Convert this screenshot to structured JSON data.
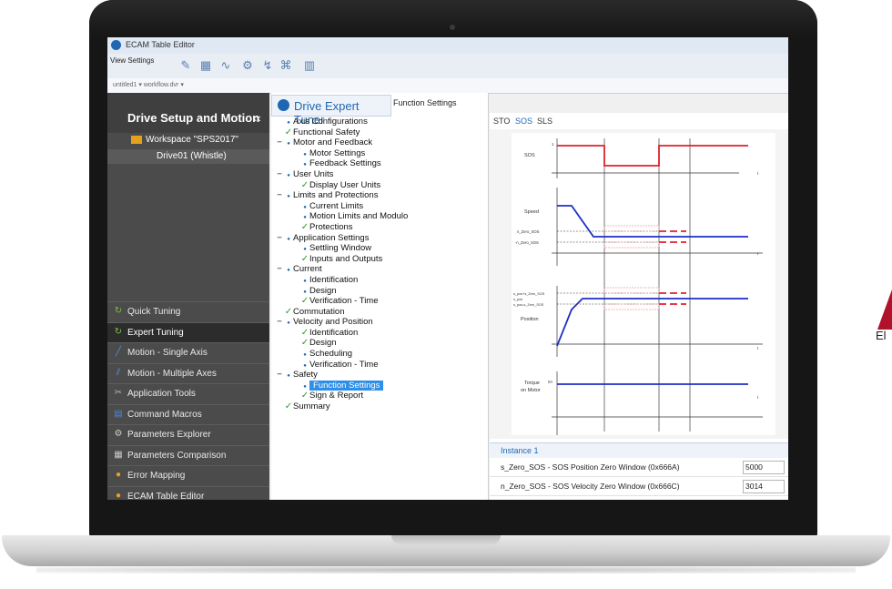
{
  "app": {
    "title": "ECAM Table Editor"
  },
  "toolbar": {
    "label": "View Settings"
  },
  "pathbar": {
    "text": "untitled1 ▾   workflow.dvr ▾"
  },
  "sidebar": {
    "header": "Drive Setup and Motion",
    "collapse": "‹‹",
    "workspace": "Workspace \"SPS2017\"",
    "drive": "Drive01 (Whistle)",
    "items": [
      {
        "label": "Quick Tuning",
        "icon": "tuning-icon",
        "glyph": "↻",
        "color": "#7bc043"
      },
      {
        "label": "Expert Tuning",
        "icon": "tuning-icon",
        "glyph": "↻",
        "color": "#7bc043"
      },
      {
        "label": "Motion - Single Axis",
        "icon": "motion-icon",
        "glyph": "╱",
        "color": "#5b8def"
      },
      {
        "label": "Motion - Multiple Axes",
        "icon": "motion-icon",
        "glyph": "⫽",
        "color": "#5b8def"
      },
      {
        "label": "Application Tools",
        "icon": "tools-icon",
        "glyph": "✂",
        "color": "#b0b0b0"
      },
      {
        "label": "Command Macros",
        "icon": "macro-icon",
        "glyph": "▤",
        "color": "#3d8be0"
      },
      {
        "label": "Parameters Explorer",
        "icon": "gear-icon",
        "glyph": "⚙",
        "color": "#c8c8c8"
      },
      {
        "label": "Parameters Comparison",
        "icon": "compare-icon",
        "glyph": "▦",
        "color": "#c8c8c8"
      },
      {
        "label": "Error Mapping",
        "icon": "error-icon",
        "glyph": "●",
        "color": "#f0a020"
      },
      {
        "label": "ECAM Table Editor",
        "icon": "ecam-icon",
        "glyph": "●",
        "color": "#f0a020"
      }
    ]
  },
  "tuner": {
    "tab": "Drive Expert Tuner",
    "subtab": "Function Settings",
    "tree": [
      {
        "label": "Axis Configurations",
        "indent": 1,
        "mark": "bullet"
      },
      {
        "label": "Functional Safety",
        "indent": 1,
        "mark": "check"
      },
      {
        "label": "Motor and Feedback",
        "indent": 0,
        "mark": "bullet",
        "group": true
      },
      {
        "label": "Motor Settings",
        "indent": 2,
        "mark": "bullet"
      },
      {
        "label": "Feedback Settings",
        "indent": 2,
        "mark": "bullet"
      },
      {
        "label": "User Units",
        "indent": 0,
        "mark": "bullet",
        "group": true
      },
      {
        "label": "Display User Units",
        "indent": 2,
        "mark": "check"
      },
      {
        "label": "Limits and Protections",
        "indent": 0,
        "mark": "bullet",
        "group": true
      },
      {
        "label": "Current Limits",
        "indent": 2,
        "mark": "bullet"
      },
      {
        "label": "Motion Limits and Modulo",
        "indent": 2,
        "mark": "bullet"
      },
      {
        "label": "Protections",
        "indent": 2,
        "mark": "check"
      },
      {
        "label": "Application Settings",
        "indent": 0,
        "mark": "bullet",
        "group": true
      },
      {
        "label": "Settling Window",
        "indent": 2,
        "mark": "bullet"
      },
      {
        "label": "Inputs and Outputs",
        "indent": 2,
        "mark": "check"
      },
      {
        "label": "Current",
        "indent": 0,
        "mark": "bullet",
        "group": true
      },
      {
        "label": "Identification",
        "indent": 2,
        "mark": "bullet"
      },
      {
        "label": "Design",
        "indent": 2,
        "mark": "bullet"
      },
      {
        "label": "Verification - Time",
        "indent": 2,
        "mark": "check"
      },
      {
        "label": "Commutation",
        "indent": 1,
        "mark": "check"
      },
      {
        "label": "Velocity and Position",
        "indent": 0,
        "mark": "bullet",
        "group": true
      },
      {
        "label": "Identification",
        "indent": 2,
        "mark": "check"
      },
      {
        "label": "Design",
        "indent": 2,
        "mark": "check"
      },
      {
        "label": "Scheduling",
        "indent": 2,
        "mark": "bullet"
      },
      {
        "label": "Verification - Time",
        "indent": 2,
        "mark": "bullet"
      },
      {
        "label": "Safety",
        "indent": 0,
        "mark": "bullet",
        "group": true
      },
      {
        "label": "Function Settings",
        "indent": 2,
        "mark": "bullet",
        "selected": true
      },
      {
        "label": "Sign & Report",
        "indent": 2,
        "mark": "check"
      },
      {
        "label": "Summary",
        "indent": 1,
        "mark": "check"
      }
    ]
  },
  "safety": {
    "tabs": [
      "STO",
      "SOS",
      "SLS"
    ],
    "active_tab": "SOS",
    "instance": "Instance 1",
    "params": [
      {
        "label": "s_Zero_SOS  - SOS Position Zero Window (0x666A)",
        "value": "5000"
      },
      {
        "label": "n_Zero_SOS  - SOS Velocity Zero Window (0x666C)",
        "value": "3014"
      }
    ]
  },
  "diagram": {
    "labels": {
      "sos": "SOS",
      "one": "1",
      "t1": "t",
      "speed": "Speed",
      "nzero_pos": "n_Zero_SOS",
      "nzero_neg": "-n_Zero_SOS",
      "t2": "t",
      "szero_pos": "s_pos+s_Zero_SOS",
      "szero_neg": "s_pos-s_Zero_SOS",
      "spos": "s_pos",
      "position": "Position",
      "t3": "t",
      "torque": "Torque",
      "on_motor": "on Motor",
      "zero": "0A",
      "t4": "t"
    },
    "colors": {
      "red": "#e0202a",
      "blue": "#1f2fc8",
      "hatch": "#f0a0a8"
    }
  },
  "brand": {
    "text": "El",
    "color": "#b0122a"
  }
}
